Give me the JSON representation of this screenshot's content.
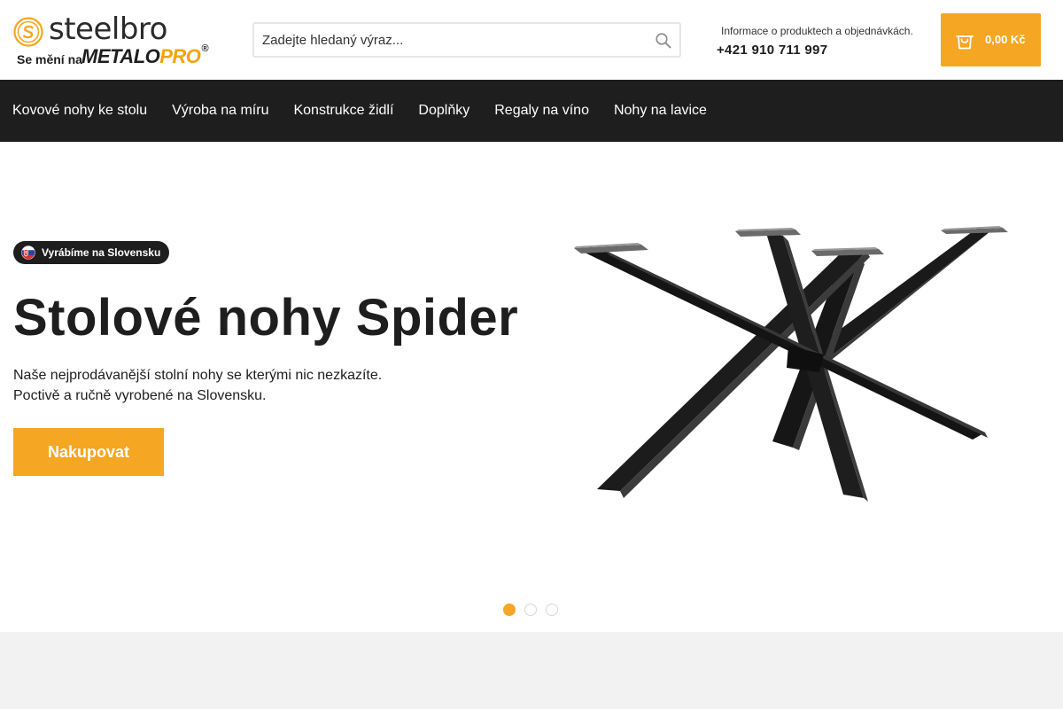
{
  "header": {
    "logo": {
      "brand": "steelbro",
      "sub_text": "Se mění na",
      "metalo_part": "METALO",
      "pro_part": "PRO",
      "registered": "®"
    },
    "search": {
      "placeholder": "Zadejte hledaný výraz..."
    },
    "contact": {
      "info": "Informace o produktech a objednávkách.",
      "phone": "+421 910 711 997"
    },
    "cart": {
      "total": "0,00 Kč"
    }
  },
  "nav": {
    "items": [
      {
        "label": "Kovové nohy ke stolu"
      },
      {
        "label": "Výroba na míru"
      },
      {
        "label": "Konstrukce židlí"
      },
      {
        "label": "Doplňky"
      },
      {
        "label": "Regaly na víno"
      },
      {
        "label": "Nohy na lavice"
      }
    ]
  },
  "hero": {
    "badge": "Vyrábíme na Slovensku",
    "title": "Stolové nohy Spider",
    "description": "Naše nejprodávanější stolní nohy se kterými nic nezkazíte. Poctivě a ručně vyrobené na Slovensku.",
    "cta": "Nakupovat",
    "slides": {
      "count": 3,
      "active": 1
    }
  },
  "colors": {
    "accent": "#f5a623",
    "dark": "#1e1e1e",
    "footer_band": "#f2f2f2"
  },
  "icons": {
    "search": "search-icon",
    "cart": "shopping-bag-icon",
    "logo": "steelbro-s-logo-icon",
    "flag": "slovakia-flag-icon"
  }
}
